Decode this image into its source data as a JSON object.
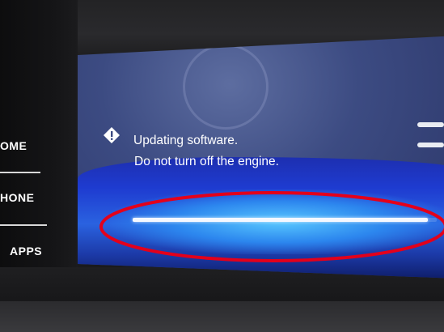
{
  "side_buttons": [
    {
      "label": "OME"
    },
    {
      "label": "HONE"
    },
    {
      "label": "APPS"
    }
  ],
  "message": {
    "line1": "Updating software.",
    "line2": "Do not turn off the engine."
  },
  "progress": {
    "value": 0.97
  },
  "alert_icon": "info-icon",
  "colors": {
    "screen_blue": "#1e3bd0",
    "annotation_red": "#e3001b",
    "text": "#ffffff"
  }
}
